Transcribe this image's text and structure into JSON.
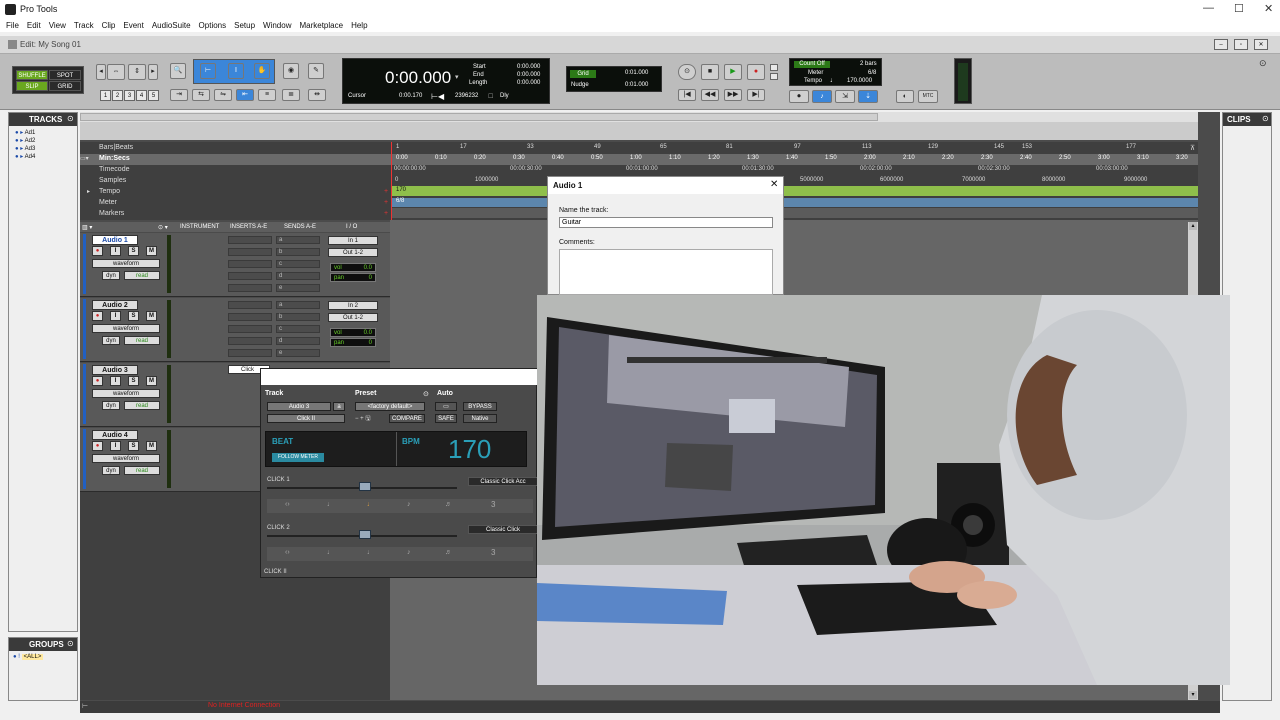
{
  "app": {
    "title": "Pro Tools",
    "edit_title": "Edit: My Song 01"
  },
  "menu": [
    "File",
    "Edit",
    "View",
    "Track",
    "Clip",
    "Event",
    "AudioSuite",
    "Options",
    "Setup",
    "Window",
    "Marketplace",
    "Help"
  ],
  "modes": {
    "shuffle": "SHUFFLE",
    "spot": "SPOT",
    "slip": "SLIP",
    "grid": "GRID"
  },
  "zoom_presets": [
    "1",
    "2",
    "3",
    "4",
    "5"
  ],
  "counter": {
    "main": "0:00.000",
    "start_label": "Start",
    "end_label": "End",
    "length_label": "Length",
    "start": "0:00.000",
    "end": "0:00.000",
    "length": "0:00.000",
    "cursor_label": "Cursor",
    "cursor": "0:00.170",
    "samples": "2396232",
    "dly": "Dly"
  },
  "grid": {
    "label": "Grid",
    "value": "0:01.000",
    "nudge_label": "Nudge",
    "nudge_value": "0:01.000"
  },
  "tempo_box": {
    "count_off": "Count Off",
    "bars": "2 bars",
    "meter_label": "Meter",
    "meter": "6/8",
    "tempo_label": "Tempo",
    "tempo": "170.0000",
    "mtc": "MTC"
  },
  "panels": {
    "tracks": "TRACKS",
    "groups": "GROUPS",
    "clips": "CLIPS",
    "all": "<ALL>"
  },
  "tracks_list": [
    "Ad1",
    "Ad2",
    "Ad3",
    "Ad4"
  ],
  "rulers": [
    "Bars|Beats",
    "Min:Secs",
    "Timecode",
    "Samples",
    "Tempo",
    "Meter",
    "Markers"
  ],
  "bars_ticks": [
    "1",
    "17",
    "33",
    "49",
    "65",
    "81",
    "97",
    "113",
    "129",
    "145",
    "153",
    "177"
  ],
  "min_ticks": [
    "0:00",
    "0:10",
    "0:20",
    "0:30",
    "0:40",
    "0:50",
    "1:00",
    "1:10",
    "1:20",
    "1:30",
    "1:40",
    "1:50",
    "2:00",
    "2:10",
    "2:20",
    "2:30",
    "2:40",
    "2:50",
    "3:00",
    "3:10",
    "3:20"
  ],
  "tc_ticks": [
    "00:00:00:00",
    "00:00:30:00",
    "00:01:00:00",
    "00:01:30:00",
    "00:02:00:00",
    "00:02:30:00",
    "00:03:00:00"
  ],
  "sample_ticks": [
    "0",
    "1000000",
    "5000000",
    "6000000",
    "7000000",
    "8000000",
    "9000000"
  ],
  "tempo_marker": "170",
  "meter_marker": "6/8",
  "columns": {
    "instrument": "INSTRUMENT",
    "inserts": "INSERTS A-E",
    "sends": "SENDS A-E",
    "io": "I / O"
  },
  "tracks": [
    {
      "name": "Audio 1",
      "input": "In 1",
      "output": "Out 1-2",
      "view": "waveform",
      "dyn": "dyn",
      "read": "read",
      "vol": "0.0",
      "pan": "0"
    },
    {
      "name": "Audio 2",
      "input": "In 2",
      "output": "Out 1-2",
      "view": "waveform",
      "dyn": "dyn",
      "read": "read",
      "vol": "0.0",
      "pan": "0"
    },
    {
      "name": "Audio 3",
      "view": "waveform",
      "dyn": "dyn",
      "read": "read"
    },
    {
      "name": "Audio 4",
      "view": "waveform",
      "dyn": "dyn",
      "read": "read"
    }
  ],
  "send_letters": [
    "a",
    "b",
    "c",
    "d",
    "e"
  ],
  "rec_btn": {
    "i": "I",
    "s": "S",
    "m": "M",
    "vol_label": "vol",
    "pan_label": "pan"
  },
  "plugin": {
    "tab": "Click",
    "track_label": "Track",
    "preset_label": "Preset",
    "auto_label": "Auto",
    "track_value": "Audio 3",
    "plugin_name": "Click II",
    "preset_value": "<factory default>",
    "compare": "COMPARE",
    "bypass": "BYPASS",
    "safe": "SAFE",
    "native": "Native",
    "beat": "BEAT",
    "bpm_label": "BPM",
    "bpm": "170",
    "follow": "FOLLOW METER",
    "click1": "CLICK 1",
    "click1_sound": "Classic Click Acc",
    "click2": "CLICK 2",
    "click2_sound": "Classic Click",
    "three": "3",
    "footer": "CLICK II"
  },
  "dialog": {
    "title": "Audio 1",
    "name_label": "Name the track:",
    "name_value": "Guitar",
    "comments_label": "Comments:"
  },
  "status": {
    "text": "No Internet Connection"
  }
}
